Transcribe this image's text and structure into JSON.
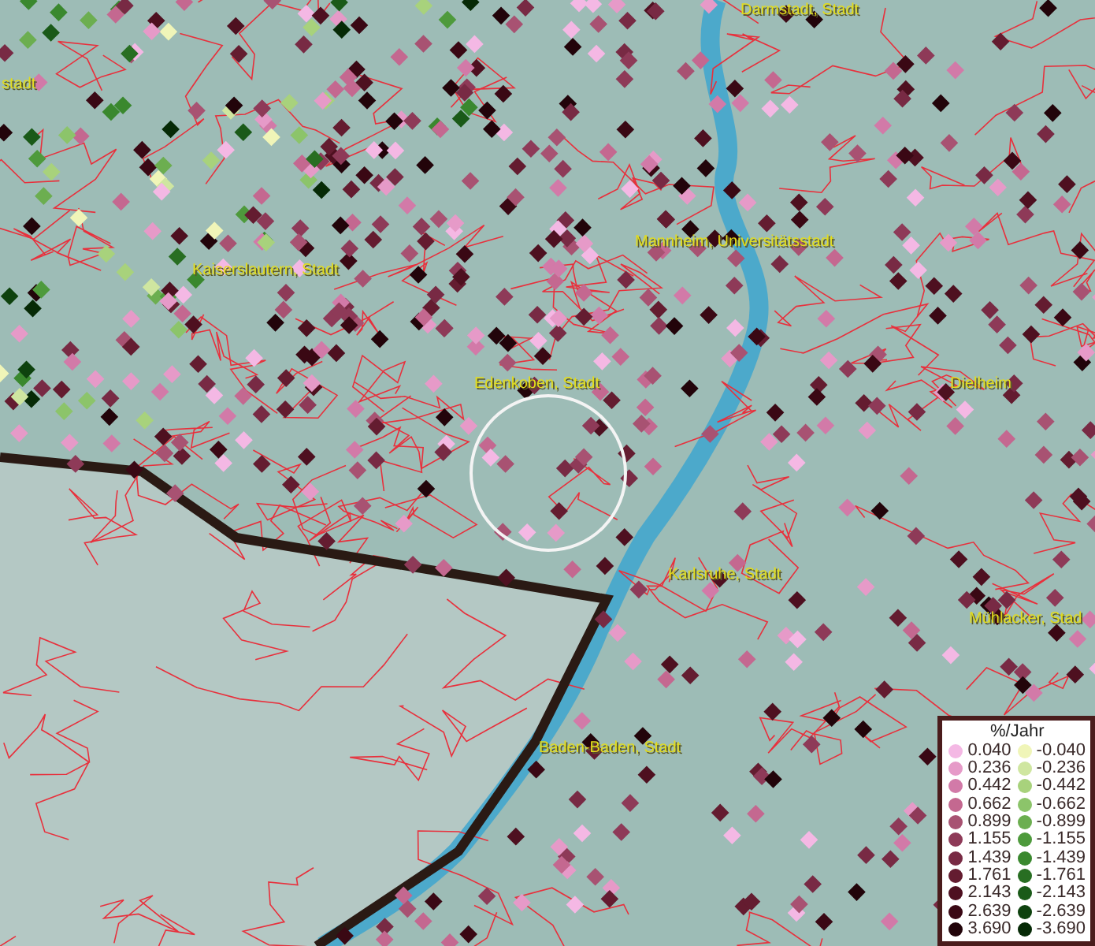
{
  "map": {
    "labels": [
      {
        "text": "Darmstadt, Stadt"
      },
      {
        "text": "stadt"
      },
      {
        "text": "Kaiserslautern, Stadt"
      },
      {
        "text": "Mannheim, Universitätsstadt"
      },
      {
        "text": "Edenkoben, Stadt"
      },
      {
        "text": "Dielheim"
      },
      {
        "text": "Karlsruhe, Stadt"
      },
      {
        "text": "Mühlacker, Stad"
      },
      {
        "text": "Baden-Baden, Stadt"
      }
    ]
  },
  "legend": {
    "title": "%/Jahr",
    "items": [
      {
        "value": "0.040",
        "color": "#f4b8e4"
      },
      {
        "value": "-0.040",
        "color": "#f0f5b8"
      },
      {
        "value": "0.236",
        "color": "#e69ac8"
      },
      {
        "value": "-0.236",
        "color": "#cfe6a0"
      },
      {
        "value": "0.442",
        "color": "#d27aa8"
      },
      {
        "value": "-0.442",
        "color": "#a8d27c"
      },
      {
        "value": "0.662",
        "color": "#c46890"
      },
      {
        "value": "-0.662",
        "color": "#8cc46a"
      },
      {
        "value": "0.899",
        "color": "#a85272"
      },
      {
        "value": "-0.899",
        "color": "#6cae50"
      },
      {
        "value": "1.155",
        "color": "#8e3a58"
      },
      {
        "value": "-1.155",
        "color": "#4e9a3c"
      },
      {
        "value": "1.439",
        "color": "#782a44"
      },
      {
        "value": "-1.439",
        "color": "#3a882e"
      },
      {
        "value": "1.761",
        "color": "#641c30"
      },
      {
        "value": "-1.761",
        "color": "#286e22"
      },
      {
        "value": "2.143",
        "color": "#4e1020"
      },
      {
        "value": "-2.143",
        "color": "#1a5a18"
      },
      {
        "value": "2.639",
        "color": "#3a0814"
      },
      {
        "value": "-2.639",
        "color": "#0e420e"
      },
      {
        "value": "3.690",
        "color": "#22040a"
      },
      {
        "value": "-3.690",
        "color": "#062a06"
      }
    ]
  }
}
